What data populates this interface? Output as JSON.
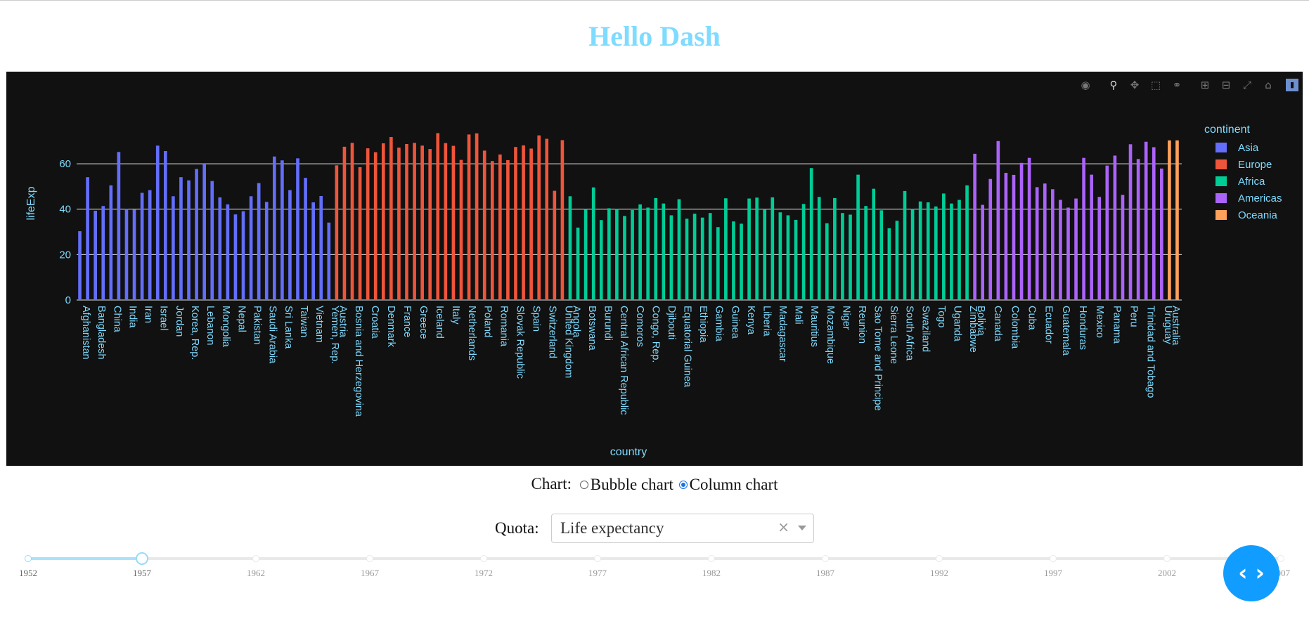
{
  "page": {
    "title": "Hello Dash"
  },
  "colors": {
    "title": "#7FDBFF",
    "plot_bg": "#111111",
    "axis_text": "#7FDBFF",
    "grid": "#ffffff"
  },
  "modebar": {
    "icons": [
      "camera-icon",
      "zoom-icon",
      "pan-icon",
      "box-select-icon",
      "lasso-icon",
      "zoom-in-icon",
      "zoom-out-icon",
      "autoscale-icon",
      "reset-axes-icon",
      "plotly-logo-icon"
    ]
  },
  "chart_data": {
    "type": "bar",
    "xlabel": "country",
    "ylabel": "lifeExp",
    "ylim": [
      0,
      82
    ],
    "yticks": [
      0,
      20,
      40,
      60
    ],
    "grid": true,
    "legend_title": "continent",
    "legend_position": "right",
    "groups": [
      {
        "name": "Asia",
        "color": "#636efa",
        "values": [
          30.3,
          54.1,
          39.3,
          41.4,
          50.5,
          65.2,
          40.2,
          39.9,
          47.2,
          48.4,
          68.0,
          65.6,
          45.7,
          54.1,
          52.7,
          57.7,
          60.0,
          52.4,
          45.2,
          42.1,
          37.7,
          39.1,
          45.7,
          51.5,
          43.2,
          63.2,
          61.5,
          48.4,
          62.4,
          53.8,
          43.0,
          45.8,
          34.1
        ],
        "ticks": [
          "Afghanistan",
          "Bangladesh",
          "China",
          "India",
          "Iran",
          "Israel",
          "Jordan",
          "Korea, Rep.",
          "Lebanon",
          "Mongolia",
          "Nepal",
          "Pakistan",
          "Saudi Arabia",
          "Sri Lanka",
          "Taiwan",
          "Vietnam",
          "Yemen, Rep."
        ]
      },
      {
        "name": "Europe",
        "color": "#EF553B",
        "values": [
          59.3,
          67.5,
          69.2,
          58.5,
          66.8,
          65.1,
          69.0,
          71.8,
          67.1,
          68.7,
          69.2,
          68.0,
          66.5,
          73.5,
          69.1,
          67.9,
          61.7,
          72.9,
          73.4,
          65.8,
          61.2,
          64.1,
          61.6,
          67.4,
          68.1,
          66.7,
          72.5,
          71.0,
          48.1,
          70.4
        ],
        "ticks": [
          "Austria",
          "Bosnia and Herzegovina",
          "Croatia",
          "Denmark",
          "France",
          "Greece",
          "Iceland",
          "Italy",
          "Netherlands",
          "Poland",
          "Romania",
          "Slovak Republic",
          "Spain",
          "Switzerland",
          "United Kingdom"
        ]
      },
      {
        "name": "Africa",
        "color": "#00cc96",
        "values": [
          45.7,
          31.9,
          40.0,
          49.6,
          35.2,
          40.4,
          40.1,
          37.0,
          39.6,
          42.1,
          40.7,
          44.9,
          42.5,
          37.3,
          44.4,
          35.8,
          38.0,
          36.3,
          38.3,
          32.1,
          44.8,
          34.6,
          33.6,
          44.7,
          45.1,
          40.0,
          45.2,
          38.6,
          37.3,
          35.3,
          42.3,
          58.1,
          45.4,
          33.8,
          44.9,
          38.3,
          37.6,
          55.2,
          41.4,
          49.0,
          39.5,
          31.6,
          34.9,
          48.0,
          40.1,
          43.4,
          43.0,
          41.2,
          46.9,
          42.5,
          44.1,
          50.5
        ],
        "ticks": [
          "Angola",
          "Botswana",
          "Burundi",
          "Central African Republic",
          "Comoros",
          "Congo, Rep.",
          "Djibouti",
          "Equatorial Guinea",
          "Ethiopia",
          "Gambia",
          "Guinea",
          "Kenya",
          "Liberia",
          "Madagascar",
          "Mali",
          "Mauritius",
          "Mozambique",
          "Niger",
          "Reunion",
          "Sao Tome and Principe",
          "Sierra Leone",
          "South Africa",
          "Swaziland",
          "Togo",
          "Uganda",
          "Zimbabwe"
        ]
      },
      {
        "name": "Americas",
        "color": "#ab63fa",
        "values": [
          64.4,
          41.9,
          53.3,
          70.0,
          56.0,
          55.1,
          60.4,
          62.6,
          49.7,
          51.3,
          48.8,
          44.1,
          40.7,
          44.7,
          62.6,
          55.2,
          45.4,
          59.2,
          63.6,
          46.3,
          68.6,
          62.1,
          69.7,
          67.3,
          57.9
        ],
        "ticks": [
          "Bolivia",
          "Canada",
          "Colombia",
          "Cuba",
          "Ecuador",
          "Guatemala",
          "Honduras",
          "Mexico",
          "Panama",
          "Peru",
          "Trinidad and Tobago",
          "Uruguay"
        ]
      },
      {
        "name": "Oceania",
        "color": "#FFA15A",
        "values": [
          70.3,
          70.3
        ],
        "ticks": [
          "Australia"
        ]
      }
    ]
  },
  "controls": {
    "chart_label": "Chart:",
    "chart_options": [
      {
        "label": "Bubble chart",
        "checked": false
      },
      {
        "label": "Column chart",
        "checked": true
      }
    ],
    "quota_label": "Quota:",
    "quota_value": "Life expectancy",
    "clear_icon": "×"
  },
  "slider": {
    "marks": [
      "1952",
      "1957",
      "1962",
      "1967",
      "1972",
      "1977",
      "1982",
      "1987",
      "1992",
      "1997",
      "2002",
      "2007"
    ],
    "value": "1957"
  },
  "code_button": {
    "label": "‹ ›"
  }
}
